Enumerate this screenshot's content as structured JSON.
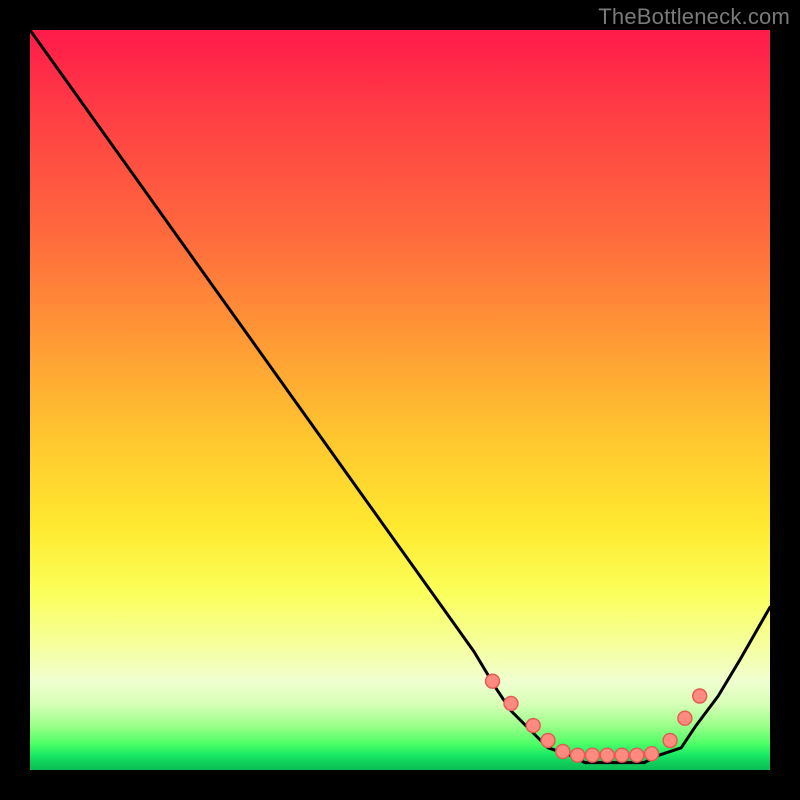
{
  "watermark": "TheBottleneck.com",
  "chart_data": {
    "type": "line",
    "xlabel": "",
    "ylabel": "",
    "xlim": [
      0,
      100
    ],
    "ylim": [
      0,
      100
    ],
    "grid": false,
    "background": "red-yellow-green vertical gradient",
    "x": [
      0,
      5,
      10,
      15,
      20,
      25,
      30,
      35,
      40,
      45,
      50,
      55,
      60,
      63,
      65,
      68,
      70,
      73,
      75,
      78,
      80,
      83,
      85,
      88,
      90,
      93,
      96,
      100
    ],
    "values": [
      100,
      93,
      86,
      79,
      72,
      65,
      58,
      51,
      44,
      37,
      30,
      23,
      16,
      11,
      8,
      5,
      3,
      2,
      1,
      1,
      1,
      1,
      2,
      3,
      6,
      10,
      15,
      22
    ],
    "series_dot_x": [
      62.5,
      65,
      68,
      70,
      72,
      74,
      76,
      78,
      80,
      82,
      84,
      86.5,
      88.5,
      90.5
    ],
    "series_dot_values": [
      12,
      9,
      6,
      4,
      2.5,
      2,
      2,
      2,
      2,
      2,
      2.2,
      4,
      7,
      10
    ],
    "annotations": []
  },
  "colors": {
    "dot_fill": "#ff8a80",
    "dot_stroke": "#e45a50",
    "curve": "#000000"
  }
}
